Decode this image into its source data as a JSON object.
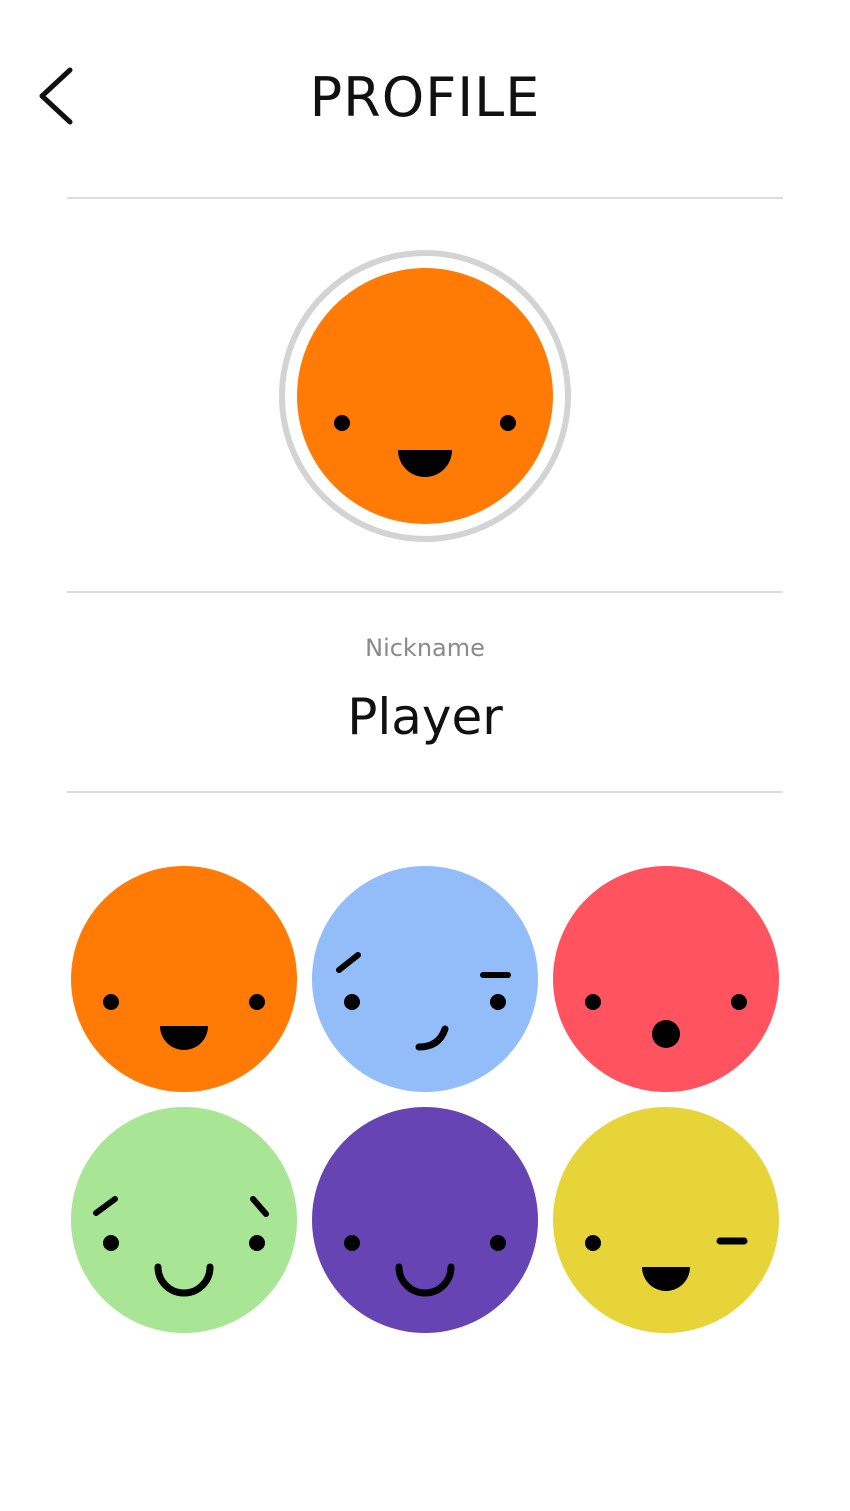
{
  "header": {
    "title": "PROFILE",
    "back_icon": "chevron-left-icon"
  },
  "profile": {
    "selected_avatar": {
      "face": "happy",
      "color": "#FF7B05",
      "ring_color": "#D3D3D3"
    },
    "nickname_label": "Nickname",
    "nickname": "Player"
  },
  "avatar_options": [
    {
      "face": "happy",
      "color": "#FF7B05"
    },
    {
      "face": "smirk",
      "color": "#92BDF8"
    },
    {
      "face": "surprised",
      "color": "#FF5360"
    },
    {
      "face": "smile-brows",
      "color": "#A8E595"
    },
    {
      "face": "smile",
      "color": "#6744B3"
    },
    {
      "face": "wink",
      "color": "#E6D438"
    }
  ]
}
